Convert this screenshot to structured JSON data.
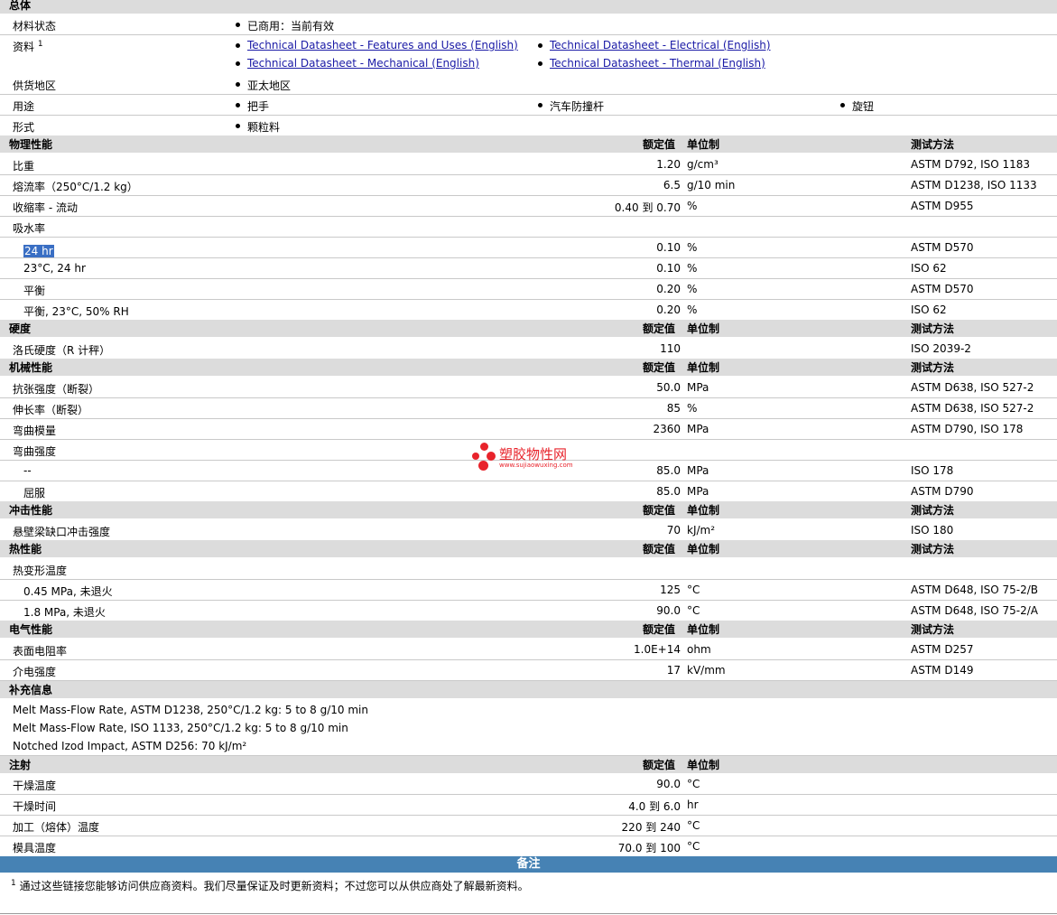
{
  "general": {
    "title": "总体",
    "status_label": "材料状态",
    "status_value": "已商用：当前有效",
    "docs_label": "资料",
    "docs_sup": "1",
    "docs": [
      "Technical Datasheet - Features and Uses (English)",
      "Technical Datasheet - Electrical (English)",
      "Technical Datasheet - Mechanical (English)",
      "Technical Datasheet - Thermal (English)"
    ],
    "region_label": "供货地区",
    "region_value": "亚太地区",
    "use_label": "用途",
    "uses": [
      "把手",
      "汽车防撞杆",
      "旋钮"
    ],
    "form_label": "形式",
    "form_value": "颗粒料"
  },
  "headers": {
    "nominal": "额定值",
    "unit": "单位制",
    "method": "测试方法"
  },
  "physical": {
    "title": "物理性能",
    "rows": [
      {
        "label": "比重",
        "value": "1.20",
        "unit": "g/cm³",
        "method": "ASTM D792, ISO 1183"
      },
      {
        "label": "熔流率（250°C/1.2 kg）",
        "value": "6.5",
        "unit": "g/10 min",
        "method": "ASTM D1238, ISO 1133"
      },
      {
        "label": "收缩率 - 流动",
        "value": "0.40 到  0.70",
        "unit": "%",
        "method": "ASTM D955"
      },
      {
        "label": "吸水率",
        "value": "",
        "unit": "",
        "method": ""
      },
      {
        "label": "24 hr",
        "value": "0.10",
        "unit": "%",
        "method": "ASTM D570"
      },
      {
        "label": "23°C, 24 hr",
        "value": "0.10",
        "unit": "%",
        "method": "ISO 62"
      },
      {
        "label": "平衡",
        "value": "0.20",
        "unit": "%",
        "method": "ASTM D570"
      },
      {
        "label": "平衡, 23°C, 50% RH",
        "value": "0.20",
        "unit": "%",
        "method": "ISO 62"
      }
    ]
  },
  "hardness": {
    "title": "硬度",
    "rows": [
      {
        "label": "洛氏硬度（R 计秤）",
        "value": "110",
        "unit": "",
        "method": "ISO 2039-2"
      }
    ]
  },
  "mechanical": {
    "title": "机械性能",
    "rows": [
      {
        "label": "抗张强度（断裂）",
        "value": "50.0",
        "unit": "MPa",
        "method": "ASTM D638, ISO 527-2"
      },
      {
        "label": "伸长率（断裂）",
        "value": "85",
        "unit": "%",
        "method": "ASTM D638, ISO 527-2"
      },
      {
        "label": "弯曲模量",
        "value": "2360",
        "unit": "MPa",
        "method": "ASTM D790, ISO 178"
      },
      {
        "label": "弯曲强度",
        "value": "",
        "unit": "",
        "method": ""
      },
      {
        "label": "--",
        "value": "85.0",
        "unit": "MPa",
        "method": "ISO 178"
      },
      {
        "label": "屈服",
        "value": "85.0",
        "unit": "MPa",
        "method": "ASTM D790"
      }
    ]
  },
  "impact": {
    "title": "冲击性能",
    "rows": [
      {
        "label": "悬壁梁缺口冲击强度",
        "value": "70",
        "unit": "kJ/m²",
        "method": "ISO 180"
      }
    ]
  },
  "thermal": {
    "title": "热性能",
    "rows": [
      {
        "label": "热变形温度",
        "value": "",
        "unit": "",
        "method": ""
      },
      {
        "label": "0.45 MPa, 未退火",
        "value": "125",
        "unit": "°C",
        "method": "ASTM D648, ISO 75-2/B"
      },
      {
        "label": "1.8 MPa, 未退火",
        "value": "90.0",
        "unit": "°C",
        "method": "ASTM D648, ISO 75-2/A"
      }
    ]
  },
  "electrical": {
    "title": "电气性能",
    "rows": [
      {
        "label": "表面电阻率",
        "value": "1.0E+14",
        "unit": "ohm",
        "method": "ASTM D257"
      },
      {
        "label": "介电强度",
        "value": "17",
        "unit": "kV/mm",
        "method": "ASTM D149"
      }
    ]
  },
  "supplement": {
    "title": "补充信息",
    "lines": [
      "Melt Mass-Flow Rate, ASTM D1238, 250°C/1.2 kg: 5 to 8 g/10 min",
      "Melt Mass-Flow Rate, ISO 1133, 250°C/1.2 kg: 5 to 8 g/10 min",
      "Notched Izod Impact, ASTM D256: 70 kJ/m²"
    ]
  },
  "injection": {
    "title": "注射",
    "rows": [
      {
        "label": "干燥温度",
        "value": "90.0",
        "unit": "°C"
      },
      {
        "label": "干燥时间",
        "value": "4.0 到  6.0",
        "unit": "hr"
      },
      {
        "label": "加工（熔体）温度",
        "value": "220 到  240",
        "unit": "°C"
      },
      {
        "label": "模具温度",
        "value": "70.0 到  100",
        "unit": "°C"
      }
    ]
  },
  "notes": {
    "title": "备注",
    "sup": "1",
    "text": "通过这些链接您能够访问供应商资料。我们尽量保证及时更新资料；不过您可以从供应商处了解最新资料。"
  },
  "watermark": {
    "name": "塑胶物性网",
    "url": "www.sujiaowuxing.com",
    "color": "#e8232b"
  }
}
